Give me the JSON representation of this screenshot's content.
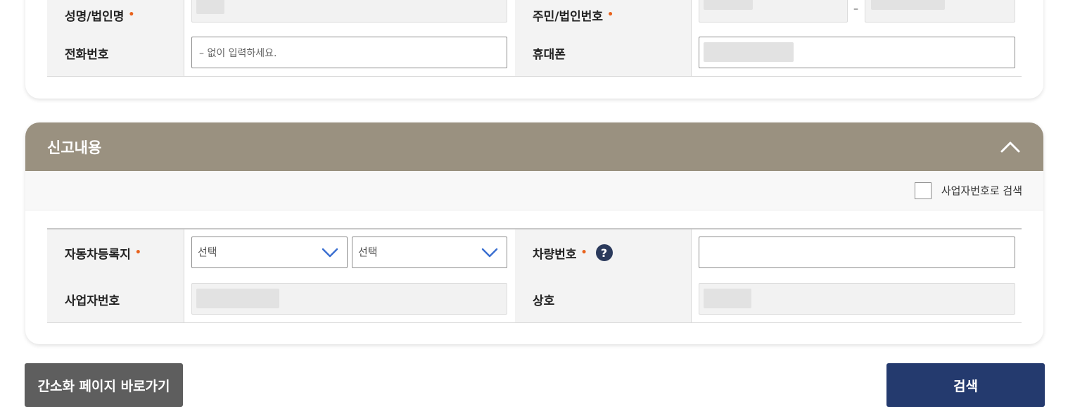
{
  "applicant": {
    "name_label": "성명/법인명",
    "id_label": "주민/법인번호",
    "id_separator": "–",
    "phone_label": "전화번호",
    "phone_placeholder": "– 없이 입력하세요.",
    "mobile_label": "휴대폰",
    "required_mark": "•"
  },
  "report": {
    "title": "신고내용",
    "collapse_icon": "chevron-up-icon",
    "search_by_business_label": "사업자번호로 검색",
    "registration_region_label": "자동차등록지",
    "region_select_1": "선택",
    "region_select_2": "선택",
    "vehicle_number_label": "차량번호",
    "help_glyph": "?",
    "business_number_label": "사업자번호",
    "company_name_label": "상호",
    "required_mark": "•"
  },
  "actions": {
    "simple_page_label": "간소화 페이지 바로가기",
    "search_label": "검색"
  },
  "colors": {
    "section_header": "#9a9180",
    "primary_button": "#243a6e",
    "secondary_button": "#5e5e5e",
    "required": "#e8621c"
  }
}
